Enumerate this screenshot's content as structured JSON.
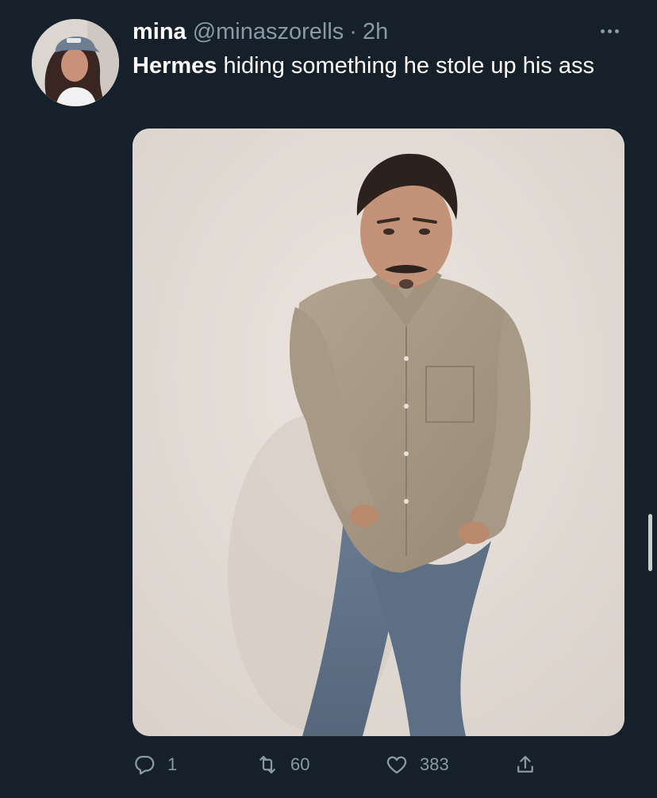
{
  "tweet": {
    "display_name": "mina",
    "handle": "@minaszorells",
    "separator": "·",
    "time": "2h",
    "text_bold": "Hermes",
    "text_rest": " hiding something he stole up his ass",
    "media_icon": "photo",
    "avatar_icon": "profile-photo"
  },
  "actions": {
    "reply_count": "1",
    "retweet_count": "60",
    "like_count": "383",
    "reply_icon": "reply-icon",
    "retweet_icon": "retweet-icon",
    "like_icon": "heart-icon",
    "share_icon": "share-icon"
  },
  "colors": {
    "background": "#15202b",
    "secondary_text": "#8b98a5",
    "primary_text": "#ffffff"
  }
}
